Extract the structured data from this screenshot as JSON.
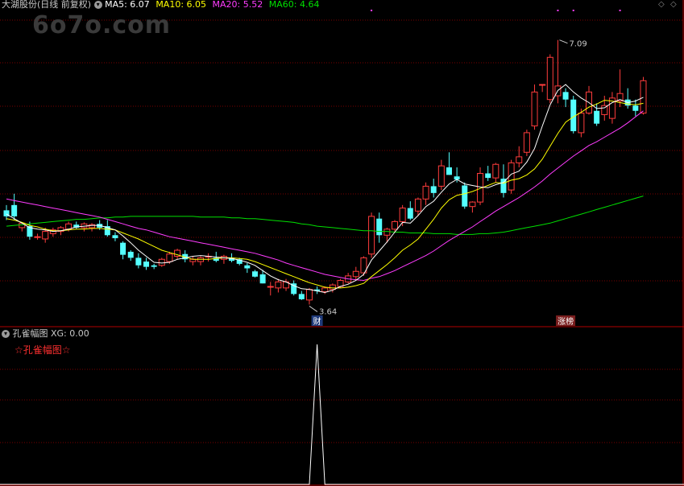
{
  "header": {
    "stock_name": "大湖股份(日线 前复权)",
    "ma5": "MA5: 6.07",
    "ma10": "MA10: 6.05",
    "ma20": "MA20: 5.52",
    "ma60": "MA60: 4.64"
  },
  "watermark": "6o7o.com",
  "indicator": {
    "title": "孔雀幅图",
    "xg": "XG: 0.00",
    "label": "☆孔雀幅图☆"
  },
  "markers": {
    "low_label": "3.64",
    "high_label": "7.09",
    "cai_badge": "财",
    "zhang_badge": "涨榜"
  },
  "colors": {
    "up": "#ff3c3c",
    "down": "#54ffff",
    "ma5": "#ffffff",
    "ma10": "#ffff00",
    "ma20": "#ff3cff",
    "ma60": "#00e000"
  },
  "chart_data": {
    "type": "candlestick",
    "price_range": [
      3.35,
      7.45
    ],
    "ohlc": [
      [
        4.83,
        4.9,
        4.7,
        4.75
      ],
      [
        4.9,
        5.05,
        4.7,
        4.75
      ],
      [
        4.6,
        4.66,
        4.55,
        4.66
      ],
      [
        4.62,
        4.68,
        4.44,
        4.48
      ],
      [
        4.48,
        4.52,
        4.44,
        4.48
      ],
      [
        4.45,
        4.6,
        4.4,
        4.55
      ],
      [
        4.52,
        4.6,
        4.48,
        4.57
      ],
      [
        4.55,
        4.62,
        4.5,
        4.6
      ],
      [
        4.58,
        4.68,
        4.55,
        4.65
      ],
      [
        4.64,
        4.68,
        4.58,
        4.6
      ],
      [
        4.6,
        4.67,
        4.55,
        4.65
      ],
      [
        4.6,
        4.66,
        4.55,
        4.64
      ],
      [
        4.65,
        4.7,
        4.57,
        4.6
      ],
      [
        4.62,
        4.7,
        4.48,
        4.5
      ],
      [
        4.5,
        4.54,
        4.42,
        4.46
      ],
      [
        4.4,
        4.42,
        4.18,
        4.24
      ],
      [
        4.28,
        4.3,
        4.16,
        4.2
      ],
      [
        4.2,
        4.26,
        4.06,
        4.1
      ],
      [
        4.15,
        4.2,
        4.04,
        4.08
      ],
      [
        4.1,
        4.12,
        4.05,
        4.08
      ],
      [
        4.1,
        4.2,
        4.08,
        4.18
      ],
      [
        4.15,
        4.28,
        4.12,
        4.25
      ],
      [
        4.22,
        4.32,
        4.18,
        4.3
      ],
      [
        4.25,
        4.3,
        4.14,
        4.18
      ],
      [
        4.15,
        4.22,
        4.1,
        4.18
      ],
      [
        4.15,
        4.22,
        4.1,
        4.2
      ],
      [
        4.22,
        4.26,
        4.15,
        4.22
      ],
      [
        4.2,
        4.28,
        4.14,
        4.16
      ],
      [
        4.18,
        4.24,
        4.12,
        4.22
      ],
      [
        4.2,
        4.26,
        4.14,
        4.16
      ],
      [
        4.18,
        4.2,
        4.1,
        4.12
      ],
      [
        4.1,
        4.13,
        4.0,
        4.06
      ],
      [
        4.02,
        4.04,
        3.94,
        3.95
      ],
      [
        3.98,
        4.04,
        3.86,
        3.86
      ],
      [
        3.82,
        3.88,
        3.7,
        3.82
      ],
      [
        3.8,
        3.92,
        3.74,
        3.88
      ],
      [
        3.8,
        3.92,
        3.76,
        3.88
      ],
      [
        3.86,
        3.9,
        3.7,
        3.72
      ],
      [
        3.72,
        3.76,
        3.64,
        3.65
      ],
      [
        3.64,
        3.8,
        3.58,
        3.78
      ],
      [
        3.78,
        3.82,
        3.72,
        3.76
      ],
      [
        3.75,
        3.82,
        3.72,
        3.8
      ],
      [
        3.78,
        3.86,
        3.74,
        3.84
      ],
      [
        3.82,
        3.92,
        3.8,
        3.9
      ],
      [
        3.88,
        4.0,
        3.86,
        3.96
      ],
      [
        3.95,
        4.08,
        3.9,
        4.02
      ],
      [
        4.0,
        4.22,
        3.96,
        4.2
      ],
      [
        4.25,
        4.8,
        4.2,
        4.75
      ],
      [
        4.72,
        4.8,
        4.4,
        4.5
      ],
      [
        4.5,
        4.6,
        4.4,
        4.58
      ],
      [
        4.58,
        4.7,
        4.55,
        4.68
      ],
      [
        4.68,
        4.9,
        4.62,
        4.86
      ],
      [
        4.86,
        4.95,
        4.7,
        4.72
      ],
      [
        4.82,
        5.0,
        4.76,
        4.98
      ],
      [
        4.98,
        5.2,
        4.9,
        5.15
      ],
      [
        5.15,
        5.25,
        5.0,
        5.06
      ],
      [
        5.15,
        5.5,
        5.1,
        5.42
      ],
      [
        5.4,
        5.6,
        5.3,
        5.3
      ],
      [
        5.28,
        5.4,
        5.2,
        5.24
      ],
      [
        5.16,
        5.2,
        4.85,
        4.88
      ],
      [
        4.88,
        4.95,
        4.8,
        4.94
      ],
      [
        4.94,
        5.4,
        4.9,
        5.32
      ],
      [
        5.32,
        5.42,
        5.22,
        5.26
      ],
      [
        5.26,
        5.46,
        5.2,
        5.44
      ],
      [
        5.25,
        5.44,
        5.0,
        5.06
      ],
      [
        5.1,
        5.5,
        5.05,
        5.46
      ],
      [
        5.46,
        5.68,
        5.4,
        5.54
      ],
      [
        5.6,
        5.9,
        5.55,
        5.86
      ],
      [
        5.95,
        6.5,
        5.9,
        6.4
      ],
      [
        6.5,
        6.5,
        6.4,
        6.5
      ],
      [
        6.3,
        6.9,
        6.25,
        6.86
      ],
      [
        6.35,
        7.09,
        6.25,
        6.48
      ],
      [
        6.4,
        6.45,
        6.2,
        6.3
      ],
      [
        6.3,
        6.35,
        5.85,
        5.88
      ],
      [
        5.86,
        6.18,
        5.8,
        6.12
      ],
      [
        6.12,
        6.48,
        6.1,
        6.4
      ],
      [
        6.15,
        6.25,
        5.95,
        5.98
      ],
      [
        6.1,
        6.35,
        6.02,
        6.22
      ],
      [
        6.05,
        6.4,
        5.98,
        6.32
      ],
      [
        6.28,
        6.7,
        6.2,
        6.38
      ],
      [
        6.3,
        6.45,
        6.18,
        6.22
      ],
      [
        6.22,
        6.3,
        6.08,
        6.15
      ],
      [
        6.12,
        6.6,
        6.1,
        6.55
      ]
    ],
    "ma5": [
      4.78,
      4.72,
      4.66,
      4.6,
      4.58,
      4.57,
      4.55,
      4.56,
      4.58,
      4.61,
      4.62,
      4.63,
      4.63,
      4.6,
      4.57,
      4.49,
      4.4,
      4.3,
      4.22,
      4.14,
      4.13,
      4.14,
      4.18,
      4.2,
      4.22,
      4.23,
      4.22,
      4.21,
      4.2,
      4.19,
      4.17,
      4.14,
      4.1,
      4.03,
      3.96,
      3.91,
      3.88,
      3.83,
      3.79,
      3.78,
      3.76,
      3.74,
      3.77,
      3.82,
      3.85,
      3.9,
      3.98,
      4.17,
      4.29,
      4.41,
      4.54,
      4.67,
      4.66,
      4.76,
      4.88,
      4.95,
      5.07,
      5.18,
      5.24,
      5.18,
      5.16,
      5.14,
      5.13,
      5.17,
      5.2,
      5.31,
      5.35,
      5.47,
      5.65,
      5.95,
      6.23,
      6.42,
      6.5,
      6.4,
      6.32,
      6.26,
      6.18,
      6.19,
      6.26,
      6.3,
      6.26,
      6.28,
      6.33
    ],
    "ma10": [
      4.72,
      4.7,
      4.67,
      4.63,
      4.61,
      4.58,
      4.56,
      4.56,
      4.57,
      4.58,
      4.58,
      4.59,
      4.59,
      4.58,
      4.57,
      4.53,
      4.49,
      4.45,
      4.4,
      4.35,
      4.3,
      4.27,
      4.24,
      4.21,
      4.18,
      4.18,
      4.18,
      4.19,
      4.2,
      4.2,
      4.19,
      4.18,
      4.15,
      4.11,
      4.07,
      4.03,
      3.99,
      3.95,
      3.91,
      3.87,
      3.84,
      3.81,
      3.8,
      3.8,
      3.81,
      3.83,
      3.86,
      3.95,
      4.03,
      4.11,
      4.2,
      4.3,
      4.37,
      4.45,
      4.58,
      4.71,
      4.86,
      4.97,
      5.03,
      5.05,
      5.08,
      5.12,
      5.16,
      5.2,
      5.19,
      5.23,
      5.25,
      5.3,
      5.38,
      5.51,
      5.68,
      5.85,
      6.0,
      6.07,
      6.13,
      6.2,
      6.24,
      6.29,
      6.28,
      6.26,
      6.24,
      6.23,
      6.25
    ],
    "ma20": [
      4.98,
      4.96,
      4.94,
      4.92,
      4.9,
      4.88,
      4.86,
      4.84,
      4.82,
      4.8,
      4.78,
      4.76,
      4.74,
      4.71,
      4.68,
      4.65,
      4.62,
      4.59,
      4.57,
      4.54,
      4.51,
      4.48,
      4.46,
      4.44,
      4.42,
      4.4,
      4.38,
      4.36,
      4.34,
      4.32,
      4.3,
      4.28,
      4.26,
      4.23,
      4.2,
      4.17,
      4.13,
      4.1,
      4.07,
      4.04,
      4.01,
      3.98,
      3.96,
      3.94,
      3.92,
      3.91,
      3.9,
      3.93,
      3.95,
      3.99,
      4.03,
      4.08,
      4.13,
      4.18,
      4.23,
      4.29,
      4.36,
      4.43,
      4.49,
      4.55,
      4.61,
      4.68,
      4.75,
      4.82,
      4.88,
      4.94,
      5.0,
      5.07,
      5.14,
      5.22,
      5.31,
      5.39,
      5.47,
      5.55,
      5.62,
      5.69,
      5.74,
      5.8,
      5.86,
      5.92,
      5.99,
      6.07,
      6.15
    ],
    "ma60": [
      4.62,
      4.63,
      4.64,
      4.65,
      4.66,
      4.67,
      4.68,
      4.69,
      4.7,
      4.71,
      4.71,
      4.72,
      4.73,
      4.73,
      4.74,
      4.74,
      4.75,
      4.75,
      4.75,
      4.75,
      4.75,
      4.75,
      4.75,
      4.75,
      4.75,
      4.74,
      4.74,
      4.74,
      4.74,
      4.73,
      4.73,
      4.72,
      4.72,
      4.71,
      4.7,
      4.69,
      4.68,
      4.67,
      4.65,
      4.64,
      4.62,
      4.61,
      4.6,
      4.59,
      4.58,
      4.57,
      4.56,
      4.56,
      4.55,
      4.55,
      4.54,
      4.54,
      4.53,
      4.53,
      4.53,
      4.52,
      4.52,
      4.52,
      4.51,
      4.51,
      4.51,
      4.52,
      4.52,
      4.53,
      4.54,
      4.56,
      4.58,
      4.6,
      4.62,
      4.64,
      4.66,
      4.69,
      4.72,
      4.75,
      4.78,
      4.81,
      4.84,
      4.87,
      4.9,
      4.93,
      4.96,
      4.99,
      5.02
    ],
    "xg_signal": [
      0,
      0,
      0,
      0,
      0,
      0,
      0,
      0,
      0,
      0,
      0,
      0,
      0,
      0,
      0,
      0,
      0,
      0,
      0,
      0,
      0,
      0,
      0,
      0,
      0,
      0,
      0,
      0,
      0,
      0,
      0,
      0,
      0,
      0,
      0,
      0,
      0,
      0,
      0,
      0,
      1,
      0,
      0,
      0,
      0,
      0,
      0,
      0,
      0,
      0,
      0,
      0,
      0,
      0,
      0,
      0,
      0,
      0,
      0,
      0,
      0,
      0,
      0,
      0,
      0,
      0,
      0,
      0,
      0,
      0,
      0,
      0,
      0,
      0,
      0,
      0,
      0,
      0,
      0,
      0,
      0,
      0,
      0,
      0,
      0
    ]
  }
}
